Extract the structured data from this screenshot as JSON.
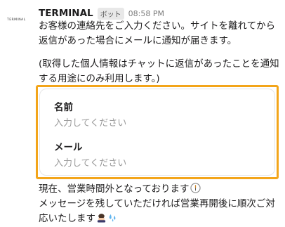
{
  "message": {
    "avatar_text": "TERMINAL",
    "sender": "TERMINAL",
    "badge": "ボット",
    "time": "08:58 PM",
    "intro": "お客様の連絡先をご入力ください。サイトを離れてから返信があった場合にメールに通知が届きます。",
    "privacy_note": "(取得した個人情報はチャットに返信があったことを通知する用途にのみ利用します。)",
    "hours_line_1": "現在、営業時間外となっております",
    "hours_line_2": "メッセージを残していただければ営業再開後に順次ご対応いたします"
  },
  "form": {
    "name_label": "名前",
    "name_placeholder": "入力してください",
    "name_value": "",
    "email_label": "メール",
    "email_placeholder": "入力してください",
    "email_value": "",
    "highlight_color": "#f3a51a"
  },
  "icons": {
    "clock": "clock-icon",
    "bowing_person": "bowing-person-icon",
    "sweat_drops": "sweat-drops-icon"
  }
}
